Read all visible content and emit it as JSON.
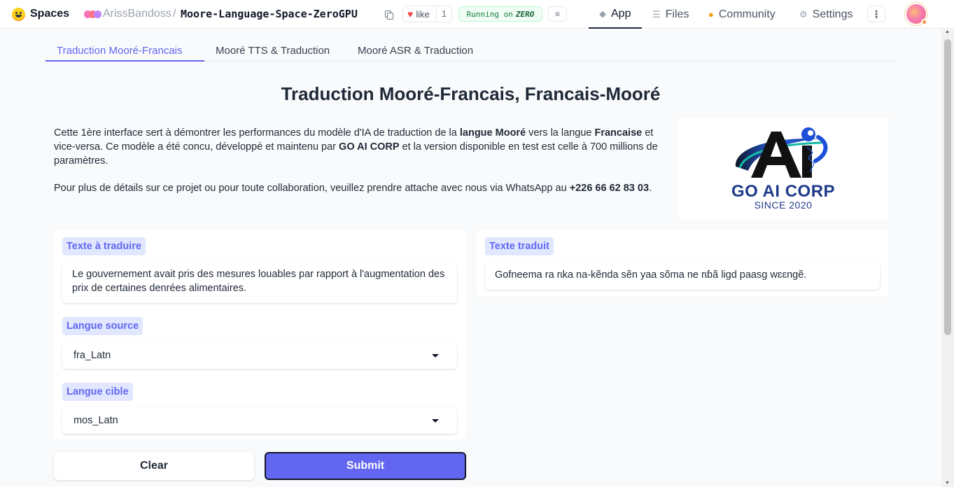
{
  "header": {
    "spaces_label": "Spaces",
    "owner": "ArissBandoss",
    "separator": "/",
    "repo": "Moore-Language-Space-ZeroGPU",
    "like_label": "like",
    "like_count": "1",
    "status_prefix": "Running on",
    "status_hardware": "ZERO",
    "nav": {
      "app": "App",
      "files": "Files",
      "community": "Community",
      "settings": "Settings"
    },
    "icons": {
      "logo": "hugging-face-logo",
      "copy": "copy-icon",
      "like": "heart-icon",
      "queue": "queue-icon",
      "app": "cube-icon",
      "files": "files-icon",
      "community": "community-icon",
      "settings": "gear-icon",
      "more": "kebab-menu-icon",
      "user": "user-avatar"
    }
  },
  "tabs": [
    {
      "label": "Traduction Mooré-Francais",
      "active": true
    },
    {
      "label": "Mooré TTS & Traduction",
      "active": false
    },
    {
      "label": "Mooré ASR & Traduction",
      "active": false
    }
  ],
  "main": {
    "title": "Traduction Mooré-Francais, Francais-Mooré",
    "description": {
      "p1_a": "Cette 1ère interface sert à démontrer les performances du modèle d'IA de traduction de la ",
      "p1_b": "langue Mooré",
      "p1_c": " vers la langue ",
      "p1_d": "Francaise",
      "p1_e": " et vice-versa. Ce modèle a été concu, développé et maintenu par ",
      "p1_f": "GO AI CORP",
      "p1_g": " et la version disponible en test est celle à 700 millions de paramètres.",
      "p2_a": "Pour plus de détails sur ce projet ou pour toute collaboration, veuillez prendre attache avec nous via WhatsApp au ",
      "p2_b": "+226 66 62 83 03",
      "p2_c": "."
    },
    "logo": {
      "mark": "Ai",
      "name": "GO AI CORP",
      "since": "SINCE 2020"
    },
    "input": {
      "label": "Texte à traduire",
      "value": "Le gouvernement avait pris des mesures louables par rapport à l'augmentation des prix de certaines denrées alimentaires."
    },
    "source_lang": {
      "label": "Langue source",
      "value": "fra_Latn"
    },
    "target_lang": {
      "label": "Langue cible",
      "value": "mos_Latn"
    },
    "output": {
      "label": "Texte traduit",
      "value": "Gofneema ra rɩka na-kẽnda sẽn yaa sõma ne rɩɓã ligd paasg wɛɛngẽ."
    },
    "buttons": {
      "clear": "Clear",
      "submit": "Submit"
    }
  },
  "colors": {
    "accent": "#6366f1",
    "label_bg": "#e0e7ff",
    "running_green": "#15803d",
    "logo_navy": "#1e3a8a"
  }
}
